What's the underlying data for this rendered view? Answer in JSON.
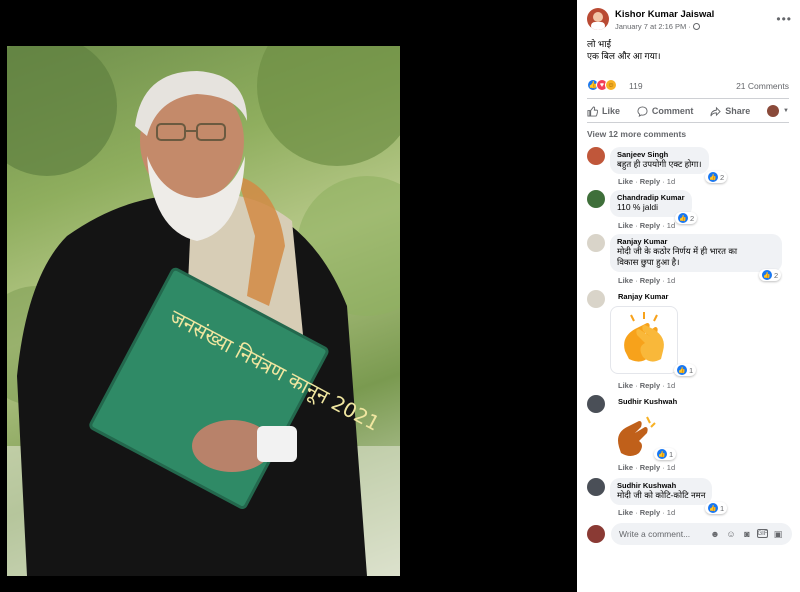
{
  "post": {
    "author": "Kishor Kumar Jaiswal",
    "timestamp": "January 7 at 2:16 PM · ",
    "privacy_icon": "globe-icon",
    "text_line1": "लो भाई",
    "text_line2": "एक बिल और आ गया।",
    "reaction_count": "119",
    "comment_count": "21 Comments",
    "photo_book_text": "जनसंख्या नियंत्रण कानून 2021"
  },
  "actions": {
    "like": "Like",
    "comment": "Comment",
    "share": "Share"
  },
  "comments_section": {
    "view_more": "View 12 more comments",
    "like_label": "Like",
    "reply_label": "Reply",
    "time_label": "1d",
    "write_placeholder": "Write a comment...",
    "items": [
      {
        "name": "Sanjeev Singh",
        "text": "बहुत ही उपयोगी एक्ट होगा।",
        "reacts": "2"
      },
      {
        "name": "Chandradip Kumar",
        "text": "110 % jaldi",
        "reacts": "2"
      },
      {
        "name": "Ranjay Kumar",
        "text_line1": "मोदी जी के कठोर निर्णय में ही भारत का",
        "text_line2": "विकास छुपा हुआ है।",
        "reacts": "2"
      },
      {
        "name": "Ranjay Kumar",
        "sticker": "clapping-hands-sticker",
        "reacts": "1"
      },
      {
        "name": "Sudhir Kushwah",
        "sticker": "clapping-hand-emoji",
        "reacts": "1"
      },
      {
        "name": "Sudhir Kushwah",
        "text": "मोदी जी को कोटि-कोटि नमन",
        "reacts": "1"
      }
    ]
  },
  "colors": {
    "like_blue": "#1877f2",
    "love_red": "#f33e58",
    "haha_yellow": "#f7b125",
    "bubble_gray": "#f0f2f5",
    "meta_gray": "#65676b"
  }
}
